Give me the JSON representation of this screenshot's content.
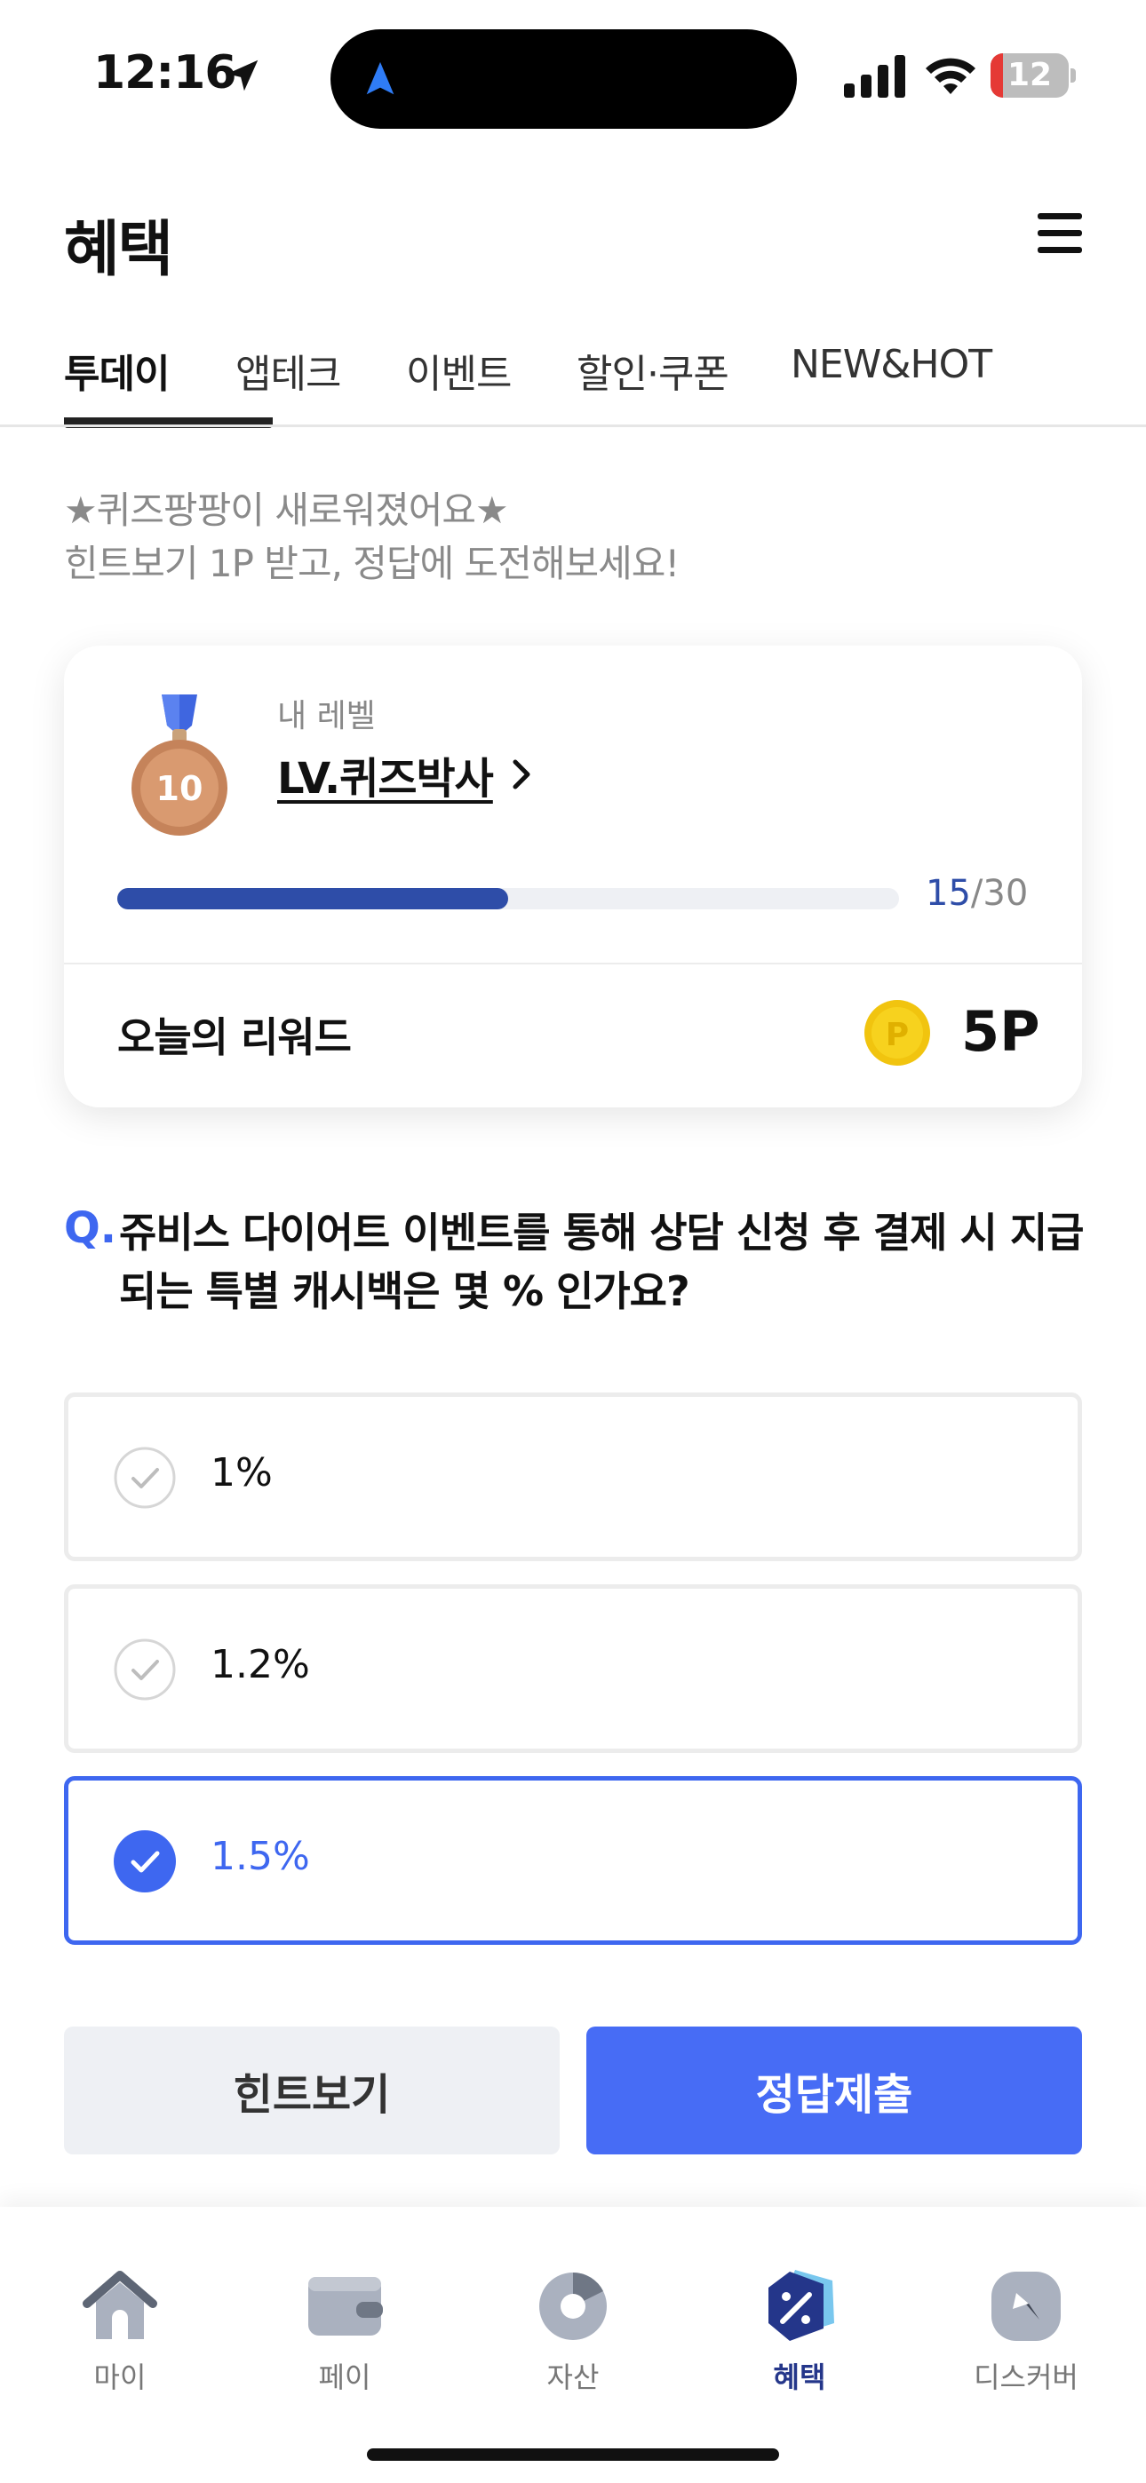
{
  "status_bar": {
    "time": "12:16",
    "battery": "12"
  },
  "header": {
    "title": "혜택",
    "menu_icon": "hamburger-menu-icon"
  },
  "tabs": [
    {
      "label": "투데이",
      "active": true
    },
    {
      "label": "앱테크",
      "active": false
    },
    {
      "label": "이벤트",
      "active": false
    },
    {
      "label": "할인·쿠폰",
      "active": false
    },
    {
      "label": "NEW&HOT",
      "active": false
    }
  ],
  "intro": {
    "line1": "★퀴즈팡팡이 새로워졌어요★",
    "line2": "힌트보기 1P 받고, 정답에 도전해보세요!"
  },
  "level_card": {
    "caption": "내 레벨",
    "name": "LV.퀴즈박사",
    "medal_number": "10",
    "progress_current": "15",
    "progress_total": "/30",
    "progress_fraction": 0.5,
    "reward_label": "오늘의 리워드",
    "reward_value": "5P"
  },
  "question": {
    "mark": "Q.",
    "text": "쥬비스 다이어트 이벤트를 통해 상담 신청 후 결제 시 지급되는 특별 캐시백은 몇 % 인가요?"
  },
  "options": [
    {
      "label": "1%",
      "selected": false
    },
    {
      "label": "1.2%",
      "selected": false
    },
    {
      "label": "1.5%",
      "selected": true
    }
  ],
  "buttons": {
    "hint": "힌트보기",
    "submit": "정답제출"
  },
  "bottom_nav": [
    {
      "label": "마이",
      "icon": "home-icon",
      "active": false
    },
    {
      "label": "페이",
      "icon": "wallet-icon",
      "active": false
    },
    {
      "label": "자산",
      "icon": "pie-chart-icon",
      "active": false
    },
    {
      "label": "혜택",
      "icon": "benefit-tag-icon",
      "active": true
    },
    {
      "label": "디스커버",
      "icon": "compass-icon",
      "active": false
    }
  ],
  "colors": {
    "accent": "#476cf5",
    "progress": "#2e4da8",
    "nav_active": "#24368a"
  }
}
